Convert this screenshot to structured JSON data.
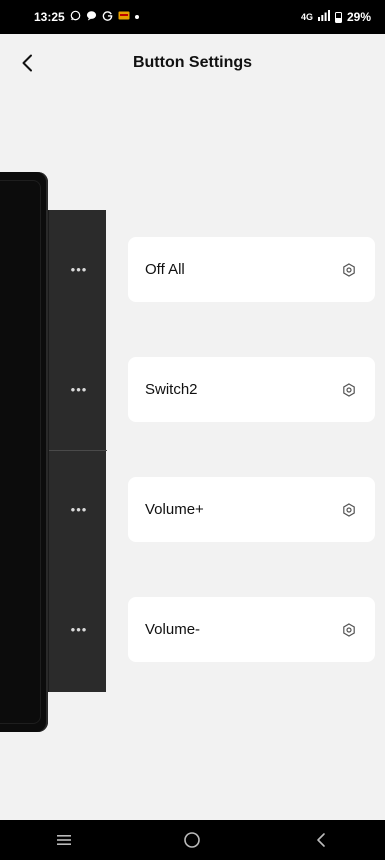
{
  "status_bar": {
    "time": "13:25",
    "icons": [
      "whatsapp-icon",
      "chat-icon",
      "google-icon",
      "sms-icon"
    ],
    "network": "4G",
    "battery": "29%"
  },
  "header": {
    "title": "Button Settings",
    "back_icon": "chevron-left-icon"
  },
  "device": {
    "button_indicator": "•••"
  },
  "buttons": [
    {
      "label": "Off All",
      "icon": "settings-gear-icon"
    },
    {
      "label": "Switch2",
      "icon": "settings-gear-icon"
    },
    {
      "label": "Volume+",
      "icon": "settings-gear-icon"
    },
    {
      "label": "Volume-",
      "icon": "settings-gear-icon"
    }
  ],
  "nav_bar": {
    "items": [
      "recent-apps-icon",
      "home-icon",
      "back-icon"
    ]
  },
  "colors": {
    "background": "#f2f2f2",
    "card": "#ffffff",
    "plate": "#2b2b2b",
    "bars": "#000000"
  }
}
